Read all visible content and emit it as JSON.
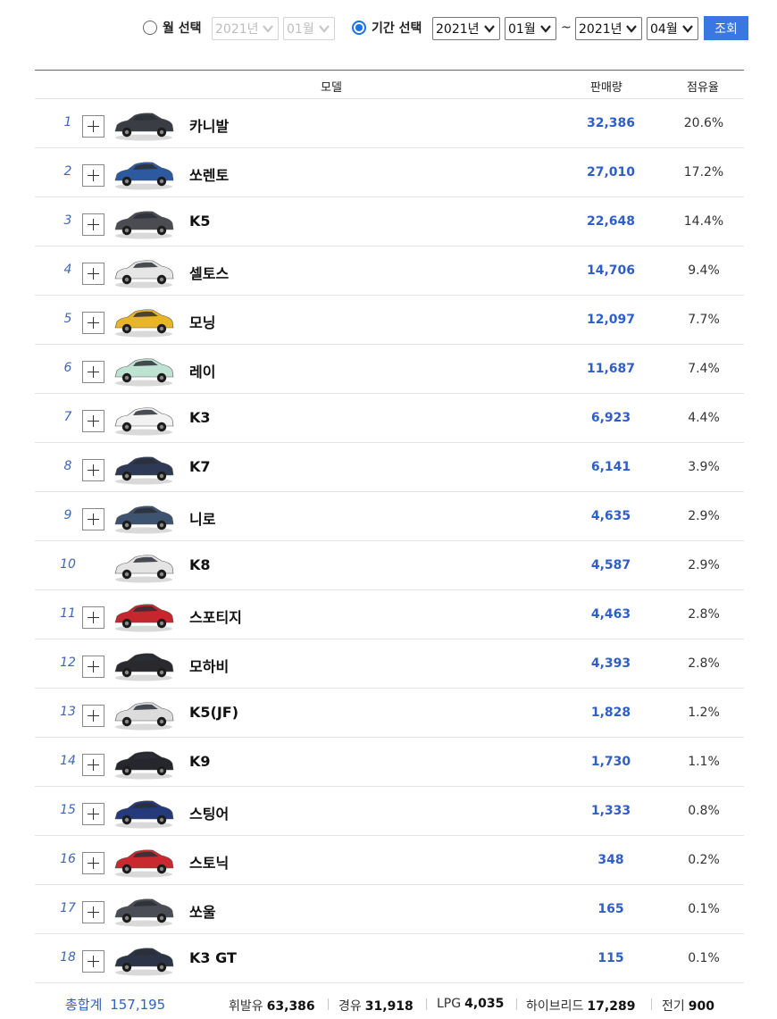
{
  "filters": {
    "month_select_label": "월 선택",
    "month_year": "2021년",
    "month_month": "01월",
    "period_select_label": "기간 선택",
    "from_year": "2021년",
    "from_month": "01월",
    "range_separator": "~",
    "to_year": "2021년",
    "to_month": "04월",
    "search_button": "조회",
    "selected_mode": "period"
  },
  "table": {
    "headers": {
      "model": "모델",
      "sales": "판매량",
      "share": "점유율"
    },
    "rows": [
      {
        "rank": "1",
        "model": "카니발",
        "sales": "32,386",
        "share": "20.6%",
        "expandable": true,
        "car_color": "#3a3d44"
      },
      {
        "rank": "2",
        "model": "쏘렌토",
        "sales": "27,010",
        "share": "17.2%",
        "expandable": true,
        "car_color": "#2d5a9e"
      },
      {
        "rank": "3",
        "model": "K5",
        "sales": "22,648",
        "share": "14.4%",
        "expandable": true,
        "car_color": "#4a4c52"
      },
      {
        "rank": "4",
        "model": "셀토스",
        "sales": "14,706",
        "share": "9.4%",
        "expandable": true,
        "car_color": "#e6e6e6"
      },
      {
        "rank": "5",
        "model": "모닝",
        "sales": "12,097",
        "share": "7.7%",
        "expandable": true,
        "car_color": "#e8b52a"
      },
      {
        "rank": "6",
        "model": "레이",
        "sales": "11,687",
        "share": "7.4%",
        "expandable": true,
        "car_color": "#bfe3d3"
      },
      {
        "rank": "7",
        "model": "K3",
        "sales": "6,923",
        "share": "4.4%",
        "expandable": true,
        "car_color": "#f2f2f2"
      },
      {
        "rank": "8",
        "model": "K7",
        "sales": "6,141",
        "share": "3.9%",
        "expandable": true,
        "car_color": "#2e3a55"
      },
      {
        "rank": "9",
        "model": "니로",
        "sales": "4,635",
        "share": "2.9%",
        "expandable": true,
        "car_color": "#3d5370"
      },
      {
        "rank": "10",
        "model": "K8",
        "sales": "4,587",
        "share": "2.9%",
        "expandable": false,
        "car_color": "#e4e4e4"
      },
      {
        "rank": "11",
        "model": "스포티지",
        "sales": "4,463",
        "share": "2.8%",
        "expandable": true,
        "car_color": "#c5282c"
      },
      {
        "rank": "12",
        "model": "모하비",
        "sales": "4,393",
        "share": "2.8%",
        "expandable": true,
        "car_color": "#2a2a2e"
      },
      {
        "rank": "13",
        "model": "K5(JF)",
        "sales": "1,828",
        "share": "1.2%",
        "expandable": true,
        "car_color": "#dcdcdc"
      },
      {
        "rank": "14",
        "model": "K9",
        "sales": "1,730",
        "share": "1.1%",
        "expandable": true,
        "car_color": "#25272c"
      },
      {
        "rank": "15",
        "model": "스팅어",
        "sales": "1,333",
        "share": "0.8%",
        "expandable": true,
        "car_color": "#243a7a"
      },
      {
        "rank": "16",
        "model": "스토닉",
        "sales": "348",
        "share": "0.2%",
        "expandable": true,
        "car_color": "#c92a30"
      },
      {
        "rank": "17",
        "model": "쏘울",
        "sales": "165",
        "share": "0.1%",
        "expandable": true,
        "car_color": "#4a4d55"
      },
      {
        "rank": "18",
        "model": "K3 GT",
        "sales": "115",
        "share": "0.1%",
        "expandable": true,
        "car_color": "#2c3547"
      }
    ]
  },
  "summary": {
    "total_label": "총합계",
    "total_value": "157,195",
    "fuels": [
      {
        "label": "휘발유",
        "value": "63,386"
      },
      {
        "label": "경유",
        "value": "31,918"
      },
      {
        "label": "LPG",
        "value": "4,035"
      },
      {
        "label": "하이브리드",
        "value": "17,289"
      },
      {
        "label": "전기",
        "value": "900"
      }
    ]
  },
  "colors": {
    "accent": "#3a77e0",
    "link_blue": "#2f5fc6",
    "rank_blue": "#3f67b4"
  }
}
